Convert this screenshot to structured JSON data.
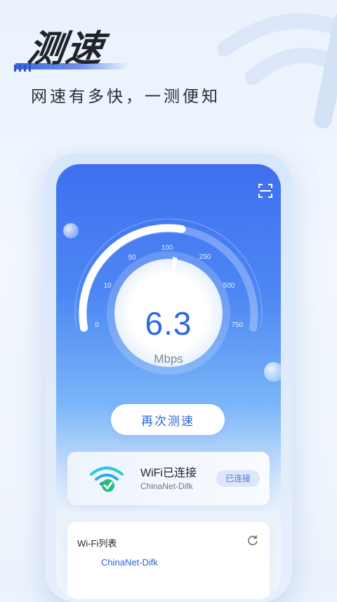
{
  "header": {
    "title": "测速",
    "subtitle": "网速有多快，一测便知"
  },
  "speedtest": {
    "value": "6.3",
    "unit": "Mbps",
    "gauge_ticks": [
      "0",
      "10",
      "50",
      "100",
      "250",
      "500",
      "750"
    ],
    "retest_button": "再次测速"
  },
  "wifi_card": {
    "title": "WiFi已连接",
    "ssid": "ChinaNet-Difk",
    "status": "已连接"
  },
  "wifi_list": {
    "title": "Wi-Fi列表",
    "first_item": "ChinaNet-Difk"
  },
  "icons": [
    "wifi-decor-icon",
    "scan-icon",
    "wifi-check-icon",
    "refresh-icon"
  ],
  "colors": {
    "accent": "#2c64dc",
    "gauge_blue": "#3f6ff0",
    "check_green": "#20c07c"
  }
}
